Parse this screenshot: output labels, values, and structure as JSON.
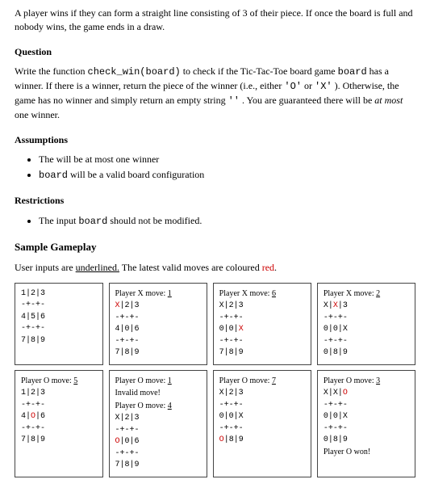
{
  "intro": {
    "p1": "A player wins if they can form a straight line consisting of 3 of their piece. If once the board is full and nobody wins, the game ends in a draw."
  },
  "question": {
    "heading": "Question",
    "pre": "Write the function ",
    "func": "check_win(board)",
    "mid1": " to check if the Tic-Tac-Toe board game ",
    "arg": "board",
    "mid2": " has a winner. If there is a winner, return the piece of the winner (i.e., either ",
    "lit_o": "'O'",
    "or": " or ",
    "lit_x": "'X'",
    "mid3": " ). Otherwise, the game has no winner and simply return an empty string ",
    "lit_empty": "''",
    "mid4": " . You are guaranteed there will be ",
    "atmost_ital": "at most",
    "atmost_rest": " one winner."
  },
  "assumptions": {
    "heading": "Assumptions",
    "b1": "The will be at most one winner",
    "b2_code": "board",
    "b2_rest": " will be a valid board configuration"
  },
  "restrictions": {
    "heading": "Restrictions",
    "b1_pre": "The input ",
    "b1_code": "board",
    "b1_post": " should not be modified."
  },
  "sample": {
    "heading": "Sample Gameplay",
    "note_pre": "User inputs are ",
    "note_ul": "underlined.",
    "note_post": " The latest valid moves are coloured ",
    "note_red": "red",
    "note_dot": "."
  },
  "row1": {
    "b1": "1|2|3\n-+-+-\n4|5|6\n-+-+-\n7|8|9",
    "b2_prompt": "Player X move: ",
    "b2_ul": "1",
    "b2_board_pre": "\n",
    "b2_mark": "X",
    "b2_board_post": "|2|3\n-+-+-\n4|0|6\n-+-+-\n7|8|9",
    "b3_prompt": "Player X move: ",
    "b3_ul": "6",
    "b3_board": "\nX|2|3\n-+-+-\n0|0|",
    "b3_mark": "X",
    "b3_rest": "\n-+-+-\n7|8|9",
    "b4_prompt": "Player X move: ",
    "b4_ul": "2",
    "b4_pre": "\nX|",
    "b4_mark": "X",
    "b4_post": "|3\n-+-+-\n0|0|X\n-+-+-\n0|8|9"
  },
  "row2": {
    "b1_prompt": "Player O move: ",
    "b1_ul": "5",
    "b1_pre": "\n1|2|3\n-+-+-\n4|",
    "b1_mark": "O",
    "b1_post": "|6\n-+-+-\n7|8|9",
    "b2_p1": "Player O move: ",
    "b2_u1": "1",
    "b2_inv": "\nInvalid move!\n",
    "b2_p2": "Player O move: ",
    "b2_u2": "4",
    "b2_pre": "\nX|2|3\n-+-+-\n",
    "b2_mark": "O",
    "b2_post": "|0|6\n-+-+-\n7|8|9",
    "b3_prompt": "Player O move: ",
    "b3_ul": "7",
    "b3_pre": "\nX|2|3\n-+-+-\n0|0|X\n-+-+-\n",
    "b3_mark": "O",
    "b3_post": "|8|9",
    "b4_prompt": "Player O move: ",
    "b4_ul": "3",
    "b4_pre": "\nX|X|",
    "b4_mark": "O",
    "b4_post": "\n-+-+-\n0|0|X\n-+-+-\n0|8|9\n",
    "b4_won": "Player O won!"
  }
}
